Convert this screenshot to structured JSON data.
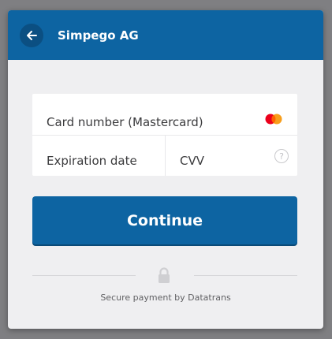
{
  "header": {
    "title": "Simpego AG",
    "back_icon": "arrow-left-icon"
  },
  "card_form": {
    "card_number_placeholder": "Card number (Mastercard)",
    "card_brand": "mastercard",
    "expiration_placeholder": "Expiration date",
    "cvv_placeholder": "CVV",
    "cvv_help_glyph": "?"
  },
  "actions": {
    "continue_label": "Continue"
  },
  "footer": {
    "secure_text": "Secure payment by Datatrans"
  },
  "colors": {
    "primary": "#0d64a2",
    "background": "#efeff1"
  }
}
